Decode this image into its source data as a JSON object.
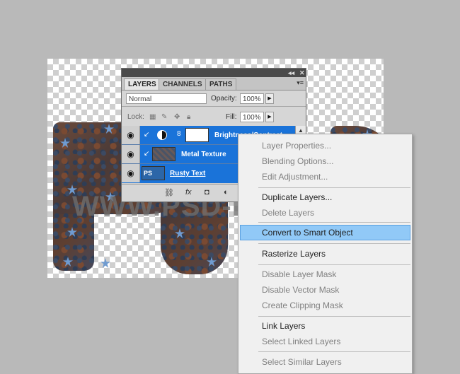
{
  "layers_panel": {
    "tabs": [
      "LAYERS",
      "CHANNELS",
      "PATHS"
    ],
    "active_tab": "LAYERS",
    "blend_mode": "Normal",
    "opacity_label": "Opacity:",
    "opacity_value": "100%",
    "lock_label": "Lock:",
    "fill_label": "Fill:",
    "fill_value": "100%",
    "layers": [
      {
        "name": "Brightness/Contrast",
        "visible": true,
        "selected": true
      },
      {
        "name": "Metal Texture",
        "visible": true,
        "selected": true
      },
      {
        "name": "Rusty Text",
        "visible": true,
        "selected": true
      }
    ]
  },
  "canvas": {
    "watermark": "WWW.PSD-DUDE.COM"
  },
  "context_menu": {
    "items": [
      {
        "label": "Layer Properties...",
        "enabled": false
      },
      {
        "label": "Blending Options...",
        "enabled": false
      },
      {
        "label": "Edit Adjustment...",
        "enabled": false
      },
      {
        "label": "Duplicate Layers...",
        "enabled": true
      },
      {
        "label": "Delete Layers",
        "enabled": false
      },
      {
        "label": "Convert to Smart Object",
        "enabled": true,
        "highlighted": true
      },
      {
        "label": "Rasterize Layers",
        "enabled": true
      },
      {
        "label": "Disable Layer Mask",
        "enabled": false
      },
      {
        "label": "Disable Vector Mask",
        "enabled": false
      },
      {
        "label": "Create Clipping Mask",
        "enabled": false
      },
      {
        "label": "Link Layers",
        "enabled": true
      },
      {
        "label": "Select Linked Layers",
        "enabled": false
      },
      {
        "label": "Select Similar Layers",
        "enabled": false
      }
    ]
  },
  "colors": {
    "selection_blue": "#1a73d9",
    "menu_highlight": "#91c9f7",
    "canvas_background": "#b9b9b9"
  }
}
